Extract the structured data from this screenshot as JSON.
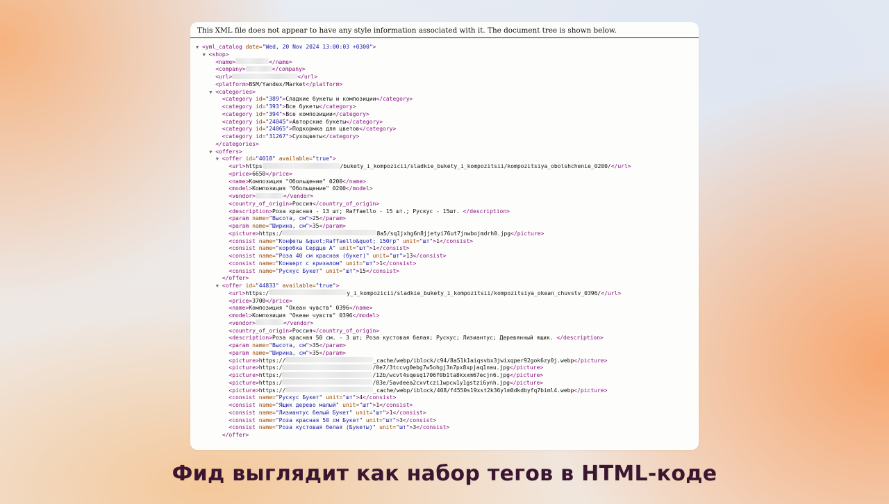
{
  "notice": "This XML file does not appear to have any style information associated with it. The document tree is shown below.",
  "caption": "Фид выглядит как набор тегов в HTML-коде",
  "lines": [
    {
      "i": 0,
      "t": 1,
      "p": [
        [
          "tg",
          "<yml_catalog "
        ],
        [
          "an",
          "date="
        ],
        [
          "av",
          "\"Wed, 20 Nov 2024 13:00:03 +0300\""
        ],
        [
          "tg",
          ">"
        ]
      ]
    },
    {
      "i": 1,
      "t": 1,
      "p": [
        [
          "tg",
          "<shop>"
        ]
      ]
    },
    {
      "i": 2,
      "t": 0,
      "p": [
        [
          "tg",
          "<name>"
        ],
        [
          "blur",
          ""
        ],
        [
          "tg",
          "</name>"
        ]
      ],
      "w": [
        48
      ]
    },
    {
      "i": 2,
      "t": 0,
      "p": [
        [
          "tg",
          "<company>"
        ],
        [
          "blur",
          ""
        ],
        [
          "tg",
          "</company>"
        ]
      ],
      "w": [
        38
      ]
    },
    {
      "i": 2,
      "t": 0,
      "p": [
        [
          "tg",
          "<url>"
        ],
        [
          "blur",
          ""
        ],
        [
          "tg",
          "</url>"
        ]
      ],
      "w": [
        94
      ]
    },
    {
      "i": 2,
      "t": 0,
      "p": [
        [
          "tg",
          "<platform>"
        ],
        [
          "tx",
          "BSM/Yandex/Market"
        ],
        [
          "tg",
          "</platform>"
        ]
      ]
    },
    {
      "i": 2,
      "t": 1,
      "p": [
        [
          "tg",
          "<categories>"
        ]
      ]
    },
    {
      "i": 3,
      "t": 0,
      "p": [
        [
          "tg",
          "<category "
        ],
        [
          "an",
          "id="
        ],
        [
          "av",
          "\"389\""
        ],
        [
          "tg",
          ">"
        ],
        [
          "tx",
          "Сладкие букеты и композиции"
        ],
        [
          "tg",
          "</category>"
        ]
      ]
    },
    {
      "i": 3,
      "t": 0,
      "p": [
        [
          "tg",
          "<category "
        ],
        [
          "an",
          "id="
        ],
        [
          "av",
          "\"393\""
        ],
        [
          "tg",
          ">"
        ],
        [
          "tx",
          "Все букеты"
        ],
        [
          "tg",
          "</category>"
        ]
      ]
    },
    {
      "i": 3,
      "t": 0,
      "p": [
        [
          "tg",
          "<category "
        ],
        [
          "an",
          "id="
        ],
        [
          "av",
          "\"394\""
        ],
        [
          "tg",
          ">"
        ],
        [
          "tx",
          "Все композиции"
        ],
        [
          "tg",
          "</category>"
        ]
      ]
    },
    {
      "i": 3,
      "t": 0,
      "p": [
        [
          "tg",
          "<category "
        ],
        [
          "an",
          "id="
        ],
        [
          "av",
          "\"24045\""
        ],
        [
          "tg",
          ">"
        ],
        [
          "tx",
          "Авторские букеты"
        ],
        [
          "tg",
          "</category>"
        ]
      ]
    },
    {
      "i": 3,
      "t": 0,
      "p": [
        [
          "tg",
          "<category "
        ],
        [
          "an",
          "id="
        ],
        [
          "av",
          "\"24065\""
        ],
        [
          "tg",
          ">"
        ],
        [
          "tx",
          "Подкормка для цветов"
        ],
        [
          "tg",
          "</category>"
        ]
      ]
    },
    {
      "i": 3,
      "t": 0,
      "p": [
        [
          "tg",
          "<category "
        ],
        [
          "an",
          "id="
        ],
        [
          "av",
          "\"31267\""
        ],
        [
          "tg",
          ">"
        ],
        [
          "tx",
          "Сухоцветы"
        ],
        [
          "tg",
          "</category>"
        ]
      ]
    },
    {
      "i": 2,
      "t": 0,
      "p": [
        [
          "tg",
          "</categories>"
        ]
      ]
    },
    {
      "i": 2,
      "t": 1,
      "p": [
        [
          "tg",
          "<offers>"
        ]
      ]
    },
    {
      "i": 3,
      "t": 1,
      "p": [
        [
          "tg",
          "<offer "
        ],
        [
          "an",
          "id="
        ],
        [
          "av",
          "\"4018\" "
        ],
        [
          "an",
          "available="
        ],
        [
          "av",
          "\"true\""
        ],
        [
          "tg",
          ">"
        ]
      ]
    },
    {
      "i": 4,
      "t": 0,
      "p": [
        [
          "tg",
          "<url>"
        ],
        [
          "tx",
          "https"
        ],
        [
          "blur",
          ""
        ],
        [
          "tx",
          "/bukety_i_kompozicii/sladkie_bukety_i_kompozitsii/kompozitsiya_obolshchenie_0200/"
        ],
        [
          "tg",
          "</url>"
        ]
      ],
      "w": [
        112
      ]
    },
    {
      "i": 4,
      "t": 0,
      "p": [
        [
          "tg",
          "<price>"
        ],
        [
          "tx",
          "6650"
        ],
        [
          "tg",
          "</price>"
        ]
      ]
    },
    {
      "i": 4,
      "t": 0,
      "p": [
        [
          "tg",
          "<name>"
        ],
        [
          "tx",
          "Композиция \"Обольщение\" 0200"
        ],
        [
          "tg",
          "</name>"
        ]
      ]
    },
    {
      "i": 4,
      "t": 0,
      "p": [
        [
          "tg",
          "<model>"
        ],
        [
          "tx",
          "Композиция \"Обольщение\" 0200"
        ],
        [
          "tg",
          "</model>"
        ]
      ]
    },
    {
      "i": 4,
      "t": 0,
      "p": [
        [
          "tg",
          "<vendor>"
        ],
        [
          "blur",
          ""
        ],
        [
          "tg",
          "</vendor>"
        ]
      ],
      "w": [
        40
      ]
    },
    {
      "i": 4,
      "t": 0,
      "p": [
        [
          "tg",
          "<country_of_origin>"
        ],
        [
          "tx",
          "Россия"
        ],
        [
          "tg",
          "</country_of_origin>"
        ]
      ]
    },
    {
      "i": 4,
      "t": 0,
      "p": [
        [
          "tg",
          "<description>"
        ],
        [
          "tx",
          "Роза красная - 13 шт; Raffaello - 15 шт.; Рускус - 15шт. "
        ],
        [
          "tg",
          "</description>"
        ]
      ]
    },
    {
      "i": 4,
      "t": 0,
      "p": [
        [
          "tg",
          "<param "
        ],
        [
          "an",
          "name="
        ],
        [
          "av",
          "\"Высота, см\""
        ],
        [
          "tg",
          ">"
        ],
        [
          "tx",
          "25"
        ],
        [
          "tg",
          "</param>"
        ]
      ]
    },
    {
      "i": 4,
      "t": 0,
      "p": [
        [
          "tg",
          "<param "
        ],
        [
          "an",
          "name="
        ],
        [
          "av",
          "\"Ширина, см\""
        ],
        [
          "tg",
          ">"
        ],
        [
          "tx",
          "35"
        ],
        [
          "tg",
          "</param>"
        ]
      ]
    },
    {
      "i": 4,
      "t": 0,
      "p": [
        [
          "tg",
          "<picture>"
        ],
        [
          "tx",
          "https:/"
        ],
        [
          "blur",
          ""
        ],
        [
          "tx",
          "8a5/sq1jxhg6n8jjetyi76ut7jnwbojmdrh0.jpg"
        ],
        [
          "tg",
          "</picture>"
        ]
      ],
      "w": [
        136
      ]
    },
    {
      "i": 4,
      "t": 0,
      "p": [
        [
          "tg",
          "<consist "
        ],
        [
          "an",
          "name="
        ],
        [
          "av",
          "\"Конфеты &quot;Raffaello&quot; 150гр\" "
        ],
        [
          "an",
          "unit="
        ],
        [
          "av",
          "\"шт\""
        ],
        [
          "tg",
          ">"
        ],
        [
          "tx",
          "1"
        ],
        [
          "tg",
          "</consist>"
        ]
      ]
    },
    {
      "i": 4,
      "t": 0,
      "p": [
        [
          "tg",
          "<consist "
        ],
        [
          "an",
          "name="
        ],
        [
          "av",
          "\"коробка Сердце А\" "
        ],
        [
          "an",
          "unit="
        ],
        [
          "av",
          "\"шт\""
        ],
        [
          "tg",
          ">"
        ],
        [
          "tx",
          "1"
        ],
        [
          "tg",
          "</consist>"
        ]
      ]
    },
    {
      "i": 4,
      "t": 0,
      "p": [
        [
          "tg",
          "<consist "
        ],
        [
          "an",
          "name="
        ],
        [
          "av",
          "\"Роза 40 см красная (букет)\" "
        ],
        [
          "an",
          "unit="
        ],
        [
          "av",
          "\"шт\""
        ],
        [
          "tg",
          ">"
        ],
        [
          "tx",
          "13"
        ],
        [
          "tg",
          "</consist>"
        ]
      ]
    },
    {
      "i": 4,
      "t": 0,
      "p": [
        [
          "tg",
          "<consist "
        ],
        [
          "an",
          "name="
        ],
        [
          "av",
          "\"Конверт с кризалом\" "
        ],
        [
          "an",
          "unit="
        ],
        [
          "av",
          "\"шт\""
        ],
        [
          "tg",
          ">"
        ],
        [
          "tx",
          "1"
        ],
        [
          "tg",
          "</consist>"
        ]
      ]
    },
    {
      "i": 4,
      "t": 0,
      "p": [
        [
          "tg",
          "<consist "
        ],
        [
          "an",
          "name="
        ],
        [
          "av",
          "\"Рускус Букет\" "
        ],
        [
          "an",
          "unit="
        ],
        [
          "av",
          "\"шт\""
        ],
        [
          "tg",
          ">"
        ],
        [
          "tx",
          "15"
        ],
        [
          "tg",
          "</consist>"
        ]
      ]
    },
    {
      "i": 3,
      "t": 0,
      "p": [
        [
          "tg",
          "</offer>"
        ]
      ]
    },
    {
      "i": 3,
      "t": 1,
      "p": [
        [
          "tg",
          "<offer "
        ],
        [
          "an",
          "id="
        ],
        [
          "av",
          "\"44833\" "
        ],
        [
          "an",
          "available="
        ],
        [
          "av",
          "\"true\""
        ],
        [
          "tg",
          ">"
        ]
      ]
    },
    {
      "i": 4,
      "t": 0,
      "p": [
        [
          "tg",
          "<url>"
        ],
        [
          "tx",
          "https:/"
        ],
        [
          "blur",
          ""
        ],
        [
          "tx",
          "y_i_kompozicii/sladkie_bukety_i_kompozitsii/kompozitsiya_okean_chuvstv_0396/"
        ],
        [
          "tg",
          "</url>"
        ]
      ],
      "w": [
        112
      ]
    },
    {
      "i": 4,
      "t": 0,
      "p": [
        [
          "tg",
          "<price>"
        ],
        [
          "tx",
          "3700"
        ],
        [
          "tg",
          "</price>"
        ]
      ]
    },
    {
      "i": 4,
      "t": 0,
      "p": [
        [
          "tg",
          "<name>"
        ],
        [
          "tx",
          "Композиция \"Океан чувств\" 0396"
        ],
        [
          "tg",
          "</name>"
        ]
      ]
    },
    {
      "i": 4,
      "t": 0,
      "p": [
        [
          "tg",
          "<model>"
        ],
        [
          "tx",
          "Композиция \"Океан чувств\" 0396"
        ],
        [
          "tg",
          "</model>"
        ]
      ]
    },
    {
      "i": 4,
      "t": 0,
      "p": [
        [
          "tg",
          "<vendor>"
        ],
        [
          "blur",
          ""
        ],
        [
          "tg",
          "</vendor>"
        ]
      ],
      "w": [
        40
      ]
    },
    {
      "i": 4,
      "t": 0,
      "p": [
        [
          "tg",
          "<country_of_origin>"
        ],
        [
          "tx",
          "Россия"
        ],
        [
          "tg",
          "</country_of_origin>"
        ]
      ]
    },
    {
      "i": 4,
      "t": 0,
      "p": [
        [
          "tg",
          "<description>"
        ],
        [
          "tx",
          "Роза красная 50 см. - 3 шт; Роза кустовая белая; Рускус; Лизиантус; Деревянный ящик. "
        ],
        [
          "tg",
          "</description>"
        ]
      ]
    },
    {
      "i": 4,
      "t": 0,
      "p": [
        [
          "tg",
          "<param "
        ],
        [
          "an",
          "name="
        ],
        [
          "av",
          "\"Высота, см\""
        ],
        [
          "tg",
          ">"
        ],
        [
          "tx",
          "35"
        ],
        [
          "tg",
          "</param>"
        ]
      ]
    },
    {
      "i": 4,
      "t": 0,
      "p": [
        [
          "tg",
          "<param "
        ],
        [
          "an",
          "name="
        ],
        [
          "av",
          "\"Ширина, см\""
        ],
        [
          "tg",
          ">"
        ],
        [
          "tx",
          "35"
        ],
        [
          "tg",
          "</param>"
        ]
      ]
    },
    {
      "i": 4,
      "t": 0,
      "p": [
        [
          "tg",
          "<picture>"
        ],
        [
          "tx",
          "https://"
        ],
        [
          "blur",
          ""
        ],
        [
          "tx",
          "_cache/webp/iblock/c94/8a51k1aiqsvbx3jwixqper92gok6zy0j.webp"
        ],
        [
          "tg",
          "</picture>"
        ]
      ],
      "w": [
        126
      ]
    },
    {
      "i": 4,
      "t": 0,
      "p": [
        [
          "tg",
          "<picture>"
        ],
        [
          "tx",
          "https:/"
        ],
        [
          "blur",
          ""
        ],
        [
          "tx",
          "/0e7/3tccvg0ebg7w5ohgj3n7px8xpjaq1nau.jpg"
        ],
        [
          "tg",
          "</picture>"
        ]
      ],
      "w": [
        130
      ]
    },
    {
      "i": 4,
      "t": 0,
      "p": [
        [
          "tg",
          "<picture>"
        ],
        [
          "tx",
          "https:/"
        ],
        [
          "blur",
          ""
        ],
        [
          "tx",
          "/12b/wcvt4sqesq1706f0b1ta8kxxm67ecjn6.jpg"
        ],
        [
          "tg",
          "</picture>"
        ]
      ],
      "w": [
        130
      ]
    },
    {
      "i": 4,
      "t": 0,
      "p": [
        [
          "tg",
          "<picture>"
        ],
        [
          "tx",
          "https:/"
        ],
        [
          "blur",
          ""
        ],
        [
          "tx",
          "/83e/5avdeea2cxvtczi1wpcw1y1gstzi6ynh.jpg"
        ],
        [
          "tg",
          "</picture>"
        ]
      ],
      "w": [
        130
      ]
    },
    {
      "i": 4,
      "t": 0,
      "p": [
        [
          "tg",
          "<picture>"
        ],
        [
          "tx",
          "https://"
        ],
        [
          "blur",
          ""
        ],
        [
          "tx",
          "_cache/webp/iblock/408/f4550s19xst2k36ylm0dkdbyfq7biml4.webp"
        ],
        [
          "tg",
          "</picture>"
        ]
      ],
      "w": [
        126
      ]
    },
    {
      "i": 4,
      "t": 0,
      "p": [
        [
          "tg",
          "<consist "
        ],
        [
          "an",
          "name="
        ],
        [
          "av",
          "\"Рускус Букет\" "
        ],
        [
          "an",
          "unit="
        ],
        [
          "av",
          "\"шт\""
        ],
        [
          "tg",
          ">"
        ],
        [
          "tx",
          "4"
        ],
        [
          "tg",
          "</consist>"
        ]
      ]
    },
    {
      "i": 4,
      "t": 0,
      "p": [
        [
          "tg",
          "<consist "
        ],
        [
          "an",
          "name="
        ],
        [
          "av",
          "\"Ящик дерево малый\" "
        ],
        [
          "an",
          "unit="
        ],
        [
          "av",
          "\"шт\""
        ],
        [
          "tg",
          ">"
        ],
        [
          "tx",
          "1"
        ],
        [
          "tg",
          "</consist>"
        ]
      ]
    },
    {
      "i": 4,
      "t": 0,
      "p": [
        [
          "tg",
          "<consist "
        ],
        [
          "an",
          "name="
        ],
        [
          "av",
          "\"Лизиантус белый Букет\" "
        ],
        [
          "an",
          "unit="
        ],
        [
          "av",
          "\"шт\""
        ],
        [
          "tg",
          ">"
        ],
        [
          "tx",
          "1"
        ],
        [
          "tg",
          "</consist>"
        ]
      ]
    },
    {
      "i": 4,
      "t": 0,
      "p": [
        [
          "tg",
          "<consist "
        ],
        [
          "an",
          "name="
        ],
        [
          "av",
          "\"Роза красная 50 см Букет\" "
        ],
        [
          "an",
          "unit="
        ],
        [
          "av",
          "\"шт\""
        ],
        [
          "tg",
          ">"
        ],
        [
          "tx",
          "3"
        ],
        [
          "tg",
          "</consist>"
        ]
      ]
    },
    {
      "i": 4,
      "t": 0,
      "p": [
        [
          "tg",
          "<consist "
        ],
        [
          "an",
          "name="
        ],
        [
          "av",
          "\"Роза кустовая белая (Букеты)\" "
        ],
        [
          "an",
          "unit="
        ],
        [
          "av",
          "\"шт\""
        ],
        [
          "tg",
          ">"
        ],
        [
          "tx",
          "3"
        ],
        [
          "tg",
          "</consist>"
        ]
      ]
    },
    {
      "i": 3,
      "t": 0,
      "p": [
        [
          "tg",
          "</offer>"
        ]
      ]
    }
  ]
}
